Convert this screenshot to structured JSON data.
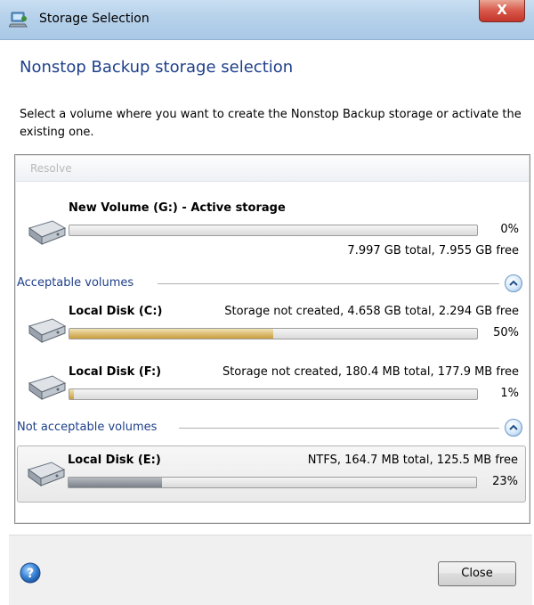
{
  "window": {
    "title": "Storage Selection",
    "close_glyph": "X"
  },
  "heading": "Nonstop Backup storage selection",
  "instruction": "Select a volume where you want to create the Nonstop Backup storage or activate the existing one.",
  "toolbar": {
    "resolve_label": "Resolve"
  },
  "active_volume": {
    "name": "New Volume (G:) - Active storage",
    "percent_label": "0%",
    "usage_fraction": 0.0,
    "info": "7.997 GB total, 7.955 GB free",
    "icon": "hard-drive-icon"
  },
  "sections": {
    "acceptable": {
      "label": "Acceptable volumes",
      "volumes": [
        {
          "name": "Local Disk (C:)",
          "info": "Storage not created, 4.658 GB total, 2.294 GB free",
          "percent_label": "50%",
          "usage_fraction": 0.5,
          "icon": "hard-drive-icon"
        },
        {
          "name": "Local Disk (F:)",
          "info": "Storage not created, 180.4 MB total, 177.9 MB free",
          "percent_label": "1%",
          "usage_fraction": 0.01,
          "icon": "hard-drive-icon"
        }
      ]
    },
    "not_acceptable": {
      "label": "Not acceptable volumes",
      "volumes": [
        {
          "name": "Local Disk (E:)",
          "info": "NTFS, 164.7 MB total, 125.5 MB free",
          "percent_label": "23%",
          "usage_fraction": 0.23,
          "icon": "hard-drive-icon"
        }
      ]
    }
  },
  "footer": {
    "help_icon": "help-icon",
    "close_label": "Close"
  },
  "colors": {
    "heading": "#1e3f8a",
    "bar_fill_acceptable": "#d9b86a",
    "bar_fill_not_acceptable": "#7a8088"
  }
}
